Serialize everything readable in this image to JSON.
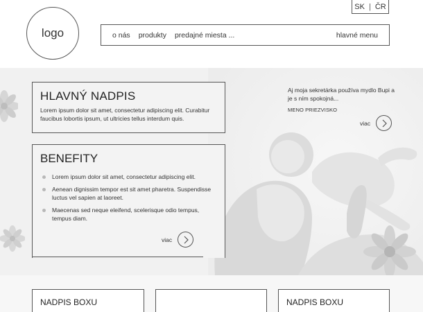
{
  "header": {
    "lang_sk": "SK",
    "lang_separator": "|",
    "lang_cr": "ČR",
    "logo_text": "logo",
    "nav_items": [
      "o nás",
      "produkty",
      "predajné miesta ..."
    ],
    "main_menu": "hlavné menu"
  },
  "hero": {
    "title": "HLAVNÝ NADPIS",
    "intro": "Lorem ipsum dolor sit amet, consectetur adipiscing elit. Curabitur faucibus lobortis ipsum, ut ultricies tellus interdum quis.",
    "benefits_title": "BENEFITY",
    "benefits": [
      "Lorem ipsum dolor sit amet, consectetur adipiscing elit.",
      "Aenean dignissim tempor est sit amet pharetra. Suspendisse luctus vel sapien at laoreet.",
      "Maecenas sed neque eleifend, scelerisque odio tempus, tempus diam."
    ],
    "benefits_more": "viac",
    "quote": "Aj moja sekretárka používa mydlo Bupi a je s ním spokojná...",
    "quote_author": "MENO PRIEZVISKO",
    "quote_more": "viac"
  },
  "boxes": {
    "box1_title": "NADPIS BOXU",
    "box2_title": "",
    "box3_title": "NADPIS BOXU"
  },
  "icons": {
    "arrow": "chevron-right-icon",
    "flower": "flower-icon"
  }
}
